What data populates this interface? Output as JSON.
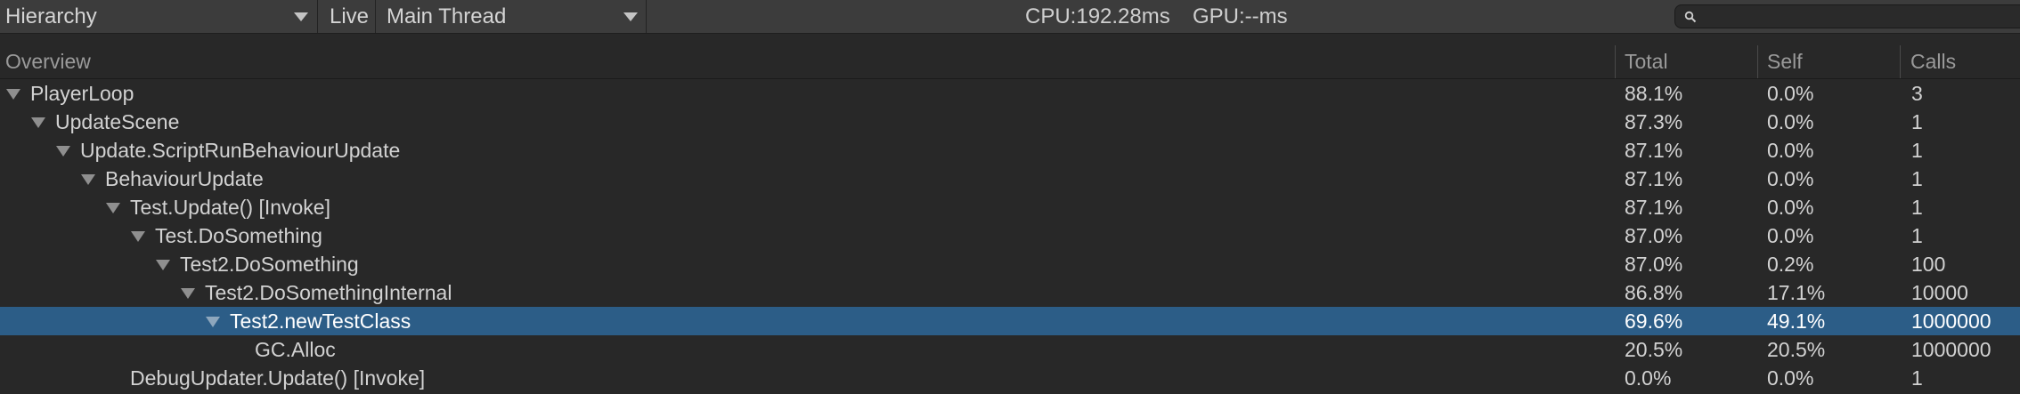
{
  "toolbar": {
    "view_mode": "Hierarchy",
    "live_label": "Live",
    "thread": "Main Thread",
    "cpu": "CPU:192.28ms",
    "gpu": "GPU:--ms",
    "search": {
      "value": "",
      "placeholder": ""
    }
  },
  "columns": {
    "overview": "Overview",
    "total": "Total",
    "self": "Self",
    "calls": "Calls"
  },
  "rows": [
    {
      "name": "PlayerLoop",
      "total": "88.1%",
      "self": "0.0%",
      "calls": "3",
      "expandable": true,
      "selected": false
    },
    {
      "name": "UpdateScene",
      "total": "87.3%",
      "self": "0.0%",
      "calls": "1",
      "expandable": true,
      "selected": false
    },
    {
      "name": "Update.ScriptRunBehaviourUpdate",
      "total": "87.1%",
      "self": "0.0%",
      "calls": "1",
      "expandable": true,
      "selected": false
    },
    {
      "name": "BehaviourUpdate",
      "total": "87.1%",
      "self": "0.0%",
      "calls": "1",
      "expandable": true,
      "selected": false
    },
    {
      "name": "Test.Update() [Invoke]",
      "total": "87.1%",
      "self": "0.0%",
      "calls": "1",
      "expandable": true,
      "selected": false
    },
    {
      "name": "Test.DoSomething",
      "total": "87.0%",
      "self": "0.0%",
      "calls": "1",
      "expandable": true,
      "selected": false
    },
    {
      "name": "Test2.DoSomething",
      "total": "87.0%",
      "self": "0.2%",
      "calls": "100",
      "expandable": true,
      "selected": false
    },
    {
      "name": "Test2.DoSomethingInternal",
      "total": "86.8%",
      "self": "17.1%",
      "calls": "10000",
      "expandable": true,
      "selected": false
    },
    {
      "name": "Test2.newTestClass",
      "total": "69.6%",
      "self": "49.1%",
      "calls": "1000000",
      "expandable": true,
      "selected": true
    },
    {
      "name": "GC.Alloc",
      "total": "20.5%",
      "self": "20.5%",
      "calls": "1000000",
      "expandable": false,
      "selected": false
    },
    {
      "name": "DebugUpdater.Update() [Invoke]",
      "total": "0.0%",
      "self": "0.0%",
      "calls": "1",
      "expandable": false,
      "selected": false
    }
  ],
  "icons": {
    "dropdown": "chevron-down-icon",
    "search": "search-icon",
    "expand": "expanded-triangle-icon"
  },
  "colors": {
    "selection": "#2c5d87",
    "background": "#282828",
    "toolbar": "#3c3c3c"
  }
}
